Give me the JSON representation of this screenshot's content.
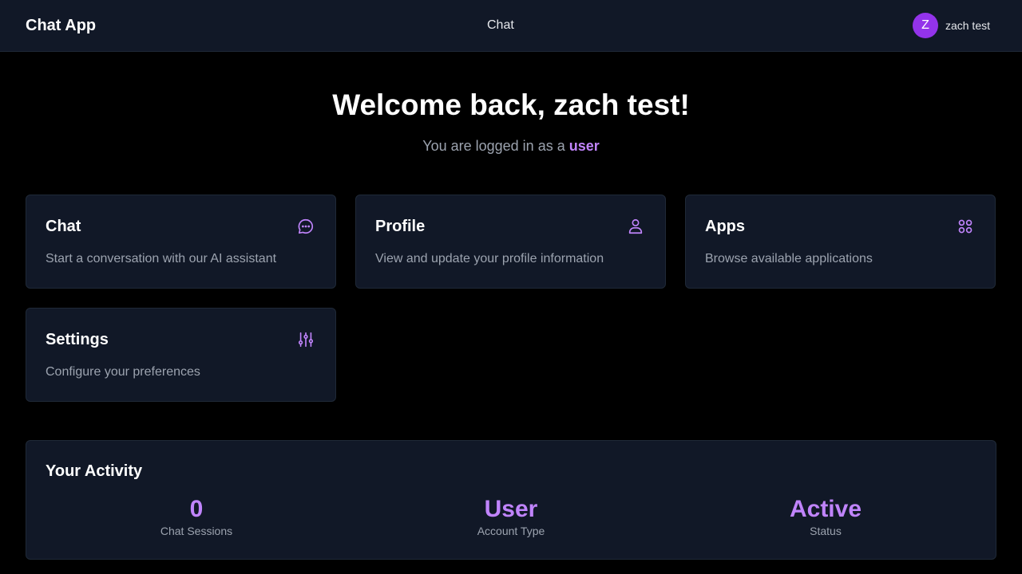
{
  "header": {
    "brand": "Chat App",
    "nav_chat": "Chat",
    "user_initial": "Z",
    "user_name": "zach test"
  },
  "welcome": {
    "title": "Welcome back, zach test!",
    "role_prefix": "You are logged in as a",
    "role": "user"
  },
  "cards": [
    {
      "title": "Chat",
      "description": "Start a conversation with our AI assistant",
      "icon": "chat-bubble-icon"
    },
    {
      "title": "Profile",
      "description": "View and update your profile information",
      "icon": "user-icon"
    },
    {
      "title": "Apps",
      "description": "Browse available applications",
      "icon": "apps-grid-icon"
    },
    {
      "title": "Settings",
      "description": "Configure your preferences",
      "icon": "sliders-icon"
    }
  ],
  "activity": {
    "title": "Your Activity",
    "stats": [
      {
        "value": "0",
        "label": "Chat Sessions"
      },
      {
        "value": "User",
        "label": "Account Type"
      },
      {
        "value": "Active",
        "label": "Status"
      }
    ]
  },
  "colors": {
    "accent": "#c084fc",
    "avatar": "#9333ea",
    "card_bg": "#111827",
    "page_bg": "#000000"
  }
}
